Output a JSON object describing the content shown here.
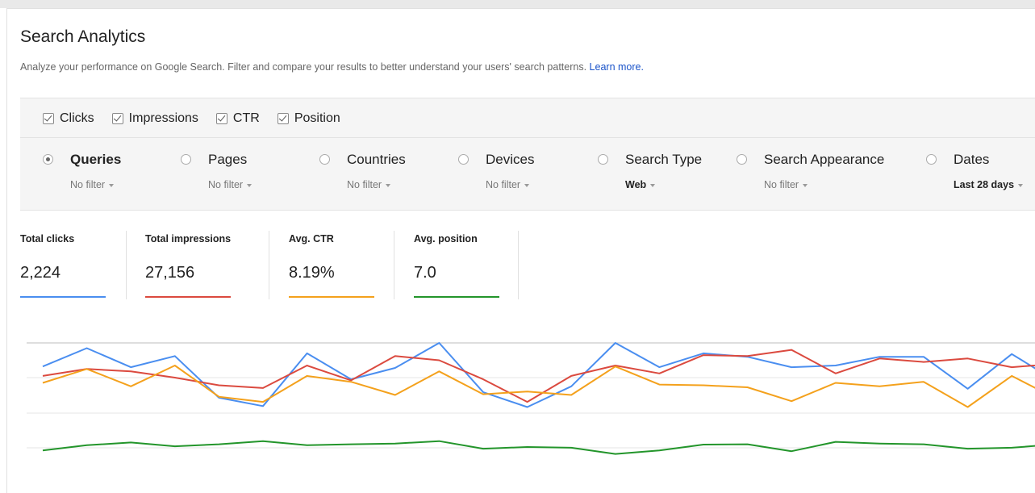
{
  "header": {
    "title": "Search Analytics",
    "subtitle": "Analyze your performance on Google Search. Filter and compare your results to better understand your users' search patterns.",
    "learn_more": "Learn more."
  },
  "metrics": [
    {
      "label": "Clicks",
      "checked": true
    },
    {
      "label": "Impressions",
      "checked": true
    },
    {
      "label": "CTR",
      "checked": true
    },
    {
      "label": "Position",
      "checked": true
    }
  ],
  "dimensions": [
    {
      "label": "Queries",
      "filter": "No filter",
      "selected": true
    },
    {
      "label": "Pages",
      "filter": "No filter",
      "selected": false
    },
    {
      "label": "Countries",
      "filter": "No filter",
      "selected": false
    },
    {
      "label": "Devices",
      "filter": "No filter",
      "selected": false
    },
    {
      "label": "Search Type",
      "filter": "Web",
      "selected": false
    },
    {
      "label": "Search Appearance",
      "filter": "No filter",
      "selected": false
    },
    {
      "label": "Dates",
      "filter": "Last 28 days",
      "selected": false
    }
  ],
  "totals": [
    {
      "label": "Total clicks",
      "value": "2,224",
      "color": "#4a8ef0"
    },
    {
      "label": "Total impressions",
      "value": "27,156",
      "color": "#db4a3f"
    },
    {
      "label": "Avg. CTR",
      "value": "8.19%",
      "color": "#f4a11c"
    },
    {
      "label": "Avg. position",
      "value": "7.0",
      "color": "#23952b"
    }
  ],
  "chart_data": {
    "type": "line",
    "x": [
      1,
      2,
      3,
      4,
      5,
      6,
      7,
      8,
      9,
      10,
      11,
      12,
      13,
      14,
      15,
      16,
      17,
      18,
      19,
      20,
      21,
      22,
      23,
      24,
      25,
      26,
      27,
      28
    ],
    "series": [
      {
        "color": "#4a8ef0",
        "values": [
          0.32,
          0.85,
          0.3,
          0.62,
          -0.58,
          -0.82,
          0.7,
          -0.05,
          0.28,
          1.0,
          -0.42,
          -0.85,
          -0.25,
          1.0,
          0.3,
          0.7,
          0.6,
          0.3,
          0.35,
          0.6,
          0.6,
          -0.32,
          0.68,
          -0.1
        ]
      },
      {
        "color": "#db4a3f",
        "values": [
          0.05,
          0.25,
          0.18,
          0.0,
          -0.22,
          -0.3,
          0.35,
          -0.08,
          0.62,
          0.5,
          -0.05,
          -0.7,
          0.05,
          0.35,
          0.12,
          0.65,
          0.62,
          0.8,
          0.12,
          0.55,
          0.45,
          0.55,
          0.3,
          0.4
        ]
      },
      {
        "color": "#f4a11c",
        "values": [
          -0.15,
          0.25,
          -0.25,
          0.35,
          -0.55,
          -0.7,
          0.05,
          -0.12,
          -0.5,
          0.18,
          -0.48,
          -0.4,
          -0.5,
          0.32,
          -0.2,
          -0.22,
          -0.28,
          -0.68,
          -0.15,
          -0.25,
          -0.12,
          -0.85,
          0.05,
          -0.6
        ]
      },
      {
        "color": "#23952b",
        "values": [
          -2.1,
          -1.95,
          -1.87,
          -1.98,
          -1.92,
          -1.83,
          -1.95,
          -1.92,
          -1.9,
          -1.83,
          -2.05,
          -2.0,
          -2.02,
          -2.2,
          -2.1,
          -1.93,
          -1.92,
          -2.12,
          -1.85,
          -1.9,
          -1.92,
          -2.05,
          -2.02,
          -1.92
        ]
      }
    ]
  }
}
